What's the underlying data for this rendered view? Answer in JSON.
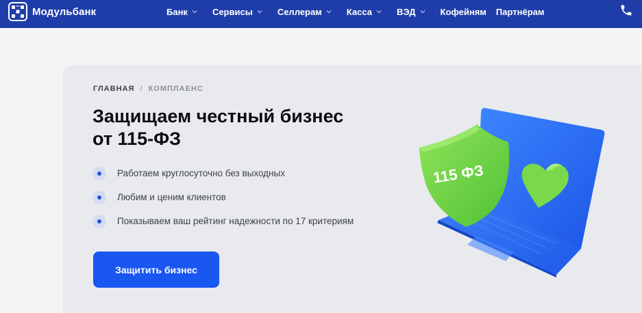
{
  "header": {
    "logo_text": "Модульбанк",
    "nav": [
      {
        "label": "Банк",
        "has_dropdown": true
      },
      {
        "label": "Сервисы",
        "has_dropdown": true
      },
      {
        "label": "Селлерам",
        "has_dropdown": true
      },
      {
        "label": "Касса",
        "has_dropdown": true
      },
      {
        "label": "ВЭД",
        "has_dropdown": true
      },
      {
        "label": "Кофейням",
        "has_dropdown": false
      },
      {
        "label": "Партнёрам",
        "has_dropdown": false
      }
    ],
    "phone_icon": "phone-icon"
  },
  "breadcrumb": {
    "home": "ГЛАВНАЯ",
    "separator": "/",
    "current": "КОМПЛАЕНС"
  },
  "hero": {
    "title_line1": "Защищаем честный бизнес",
    "title_line2": "от 115-ФЗ",
    "features": [
      "Работаем круглосуточно без выходных",
      "Любим и ценим клиентов",
      "Показываем ваш рейтинг надежности по 17 критериям"
    ],
    "cta_label": "Защитить бизнес",
    "shield_text": "115 ФЗ"
  },
  "colors": {
    "header_bg": "#1f3da8",
    "accent": "#1a56f0",
    "card_bg": "#e9eaee",
    "shield_green": "#7bd84a",
    "laptop_blue": "#2f6ff2"
  }
}
